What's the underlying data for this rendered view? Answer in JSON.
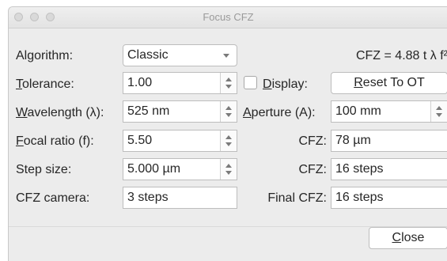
{
  "window": {
    "title": "Focus CFZ"
  },
  "algorithm": {
    "label_pre": "Al",
    "label_key": "g",
    "label_post": "orithm:",
    "value": "Classic"
  },
  "formula": "CFZ = 4.88 t λ f²",
  "tolerance": {
    "label_key": "T",
    "label_post": "olerance:",
    "value": "1.00"
  },
  "display": {
    "label_key": "D",
    "label_post": "isplay:",
    "checked": false
  },
  "reset_button": {
    "label_key": "R",
    "label_post": "eset To OT"
  },
  "wavelength": {
    "label_key": "W",
    "label_post": "avelength (λ):",
    "value": "525 nm"
  },
  "aperture": {
    "label_key": "A",
    "label_post": "perture (A):",
    "value": "100 mm"
  },
  "focal_ratio": {
    "label_key": "F",
    "label_post": "ocal ratio (f):",
    "value": "5.50"
  },
  "cfz_um": {
    "label": "CFZ:",
    "value": "78 µm"
  },
  "step_size": {
    "label": "Step size:",
    "value": "5.000 µm"
  },
  "cfz_steps": {
    "label": "CFZ:",
    "value": "16 steps"
  },
  "cfz_camera": {
    "label": "CFZ camera:",
    "value": "3 steps"
  },
  "final_cfz": {
    "label": "Final CFZ:",
    "value": "16 steps"
  },
  "close_button": {
    "label_key": "C",
    "label_post": "lose"
  }
}
